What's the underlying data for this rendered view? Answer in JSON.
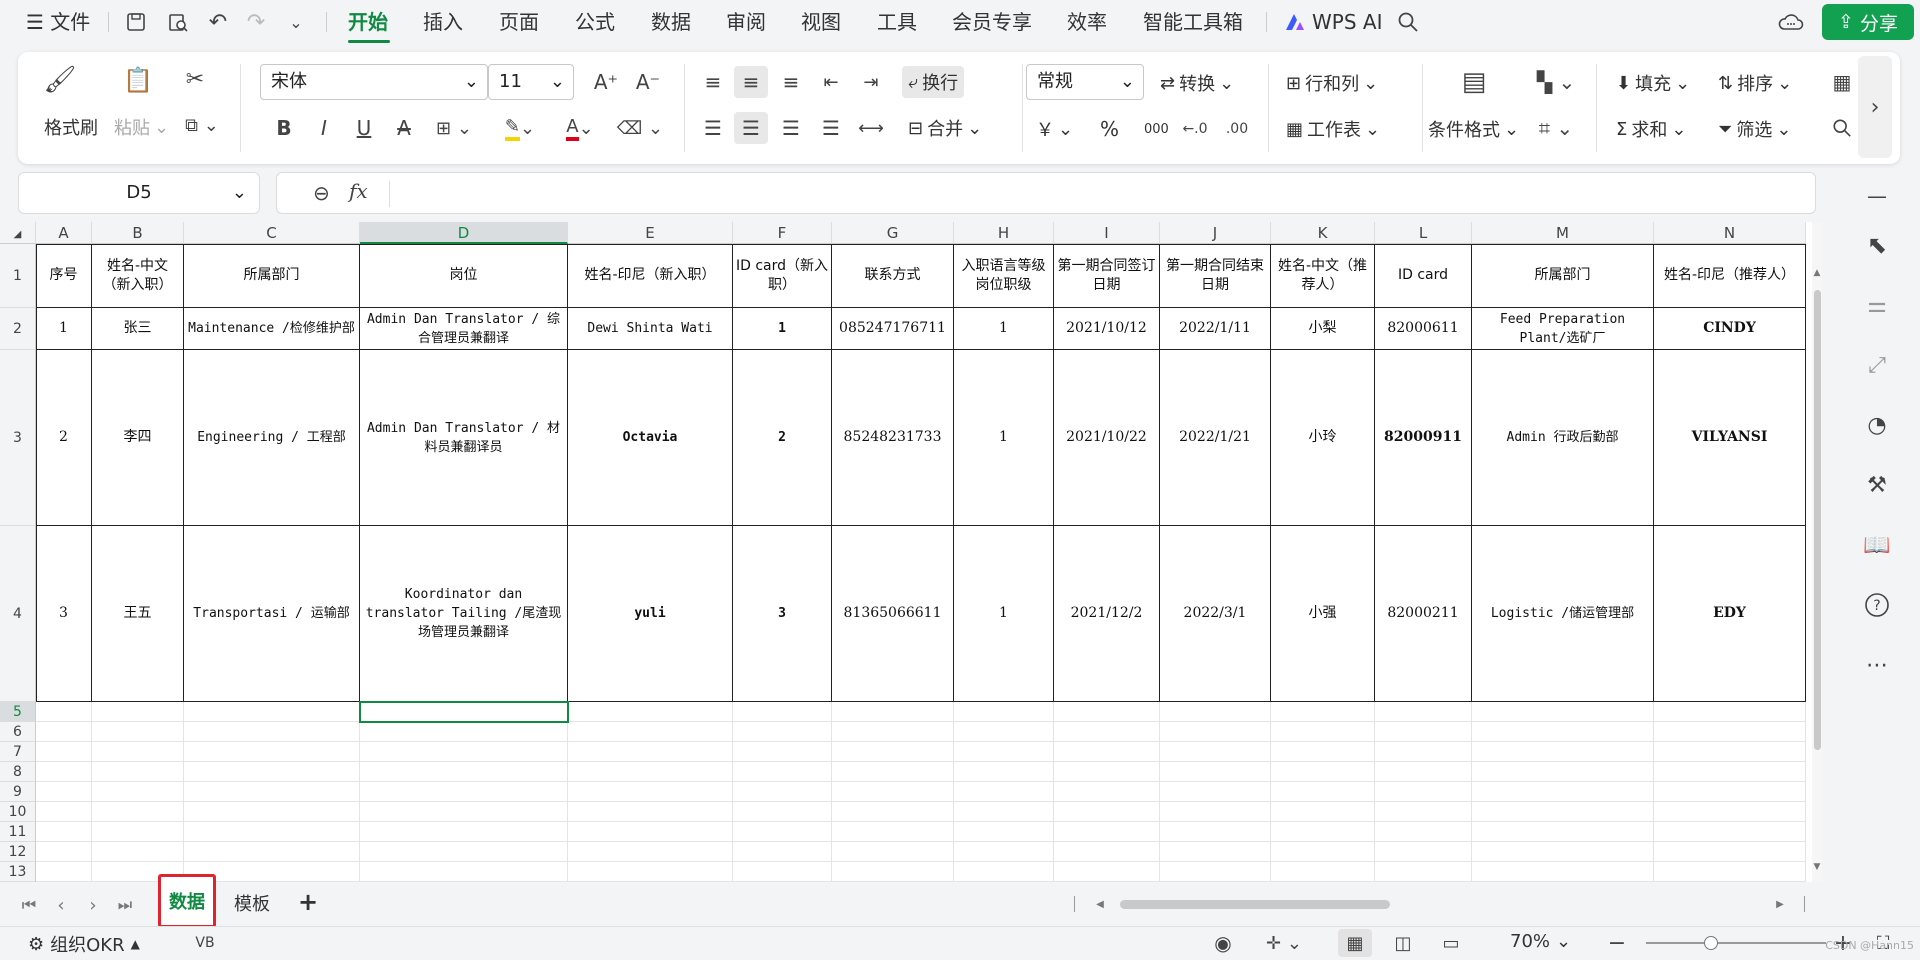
{
  "topbar": {
    "menu_label": "文件",
    "tabs": [
      "开始",
      "插入",
      "页面",
      "公式",
      "数据",
      "审阅",
      "视图",
      "工具",
      "会员专享",
      "效率",
      "智能工具箱"
    ],
    "active_tab_index": 0,
    "ai_label": "WPS AI",
    "share_label": "分享"
  },
  "ribbon": {
    "format_painter": "格式刷",
    "paste": "粘贴",
    "font_name": "宋体",
    "font_size": "11",
    "wrap": "换行",
    "merge": "合并",
    "number_format": "常规",
    "convert": "转换",
    "rows_cols": "行和列",
    "worksheet": "工作表",
    "conditional_format": "条件格式",
    "fill": "填充",
    "sort": "排序",
    "sum": "求和",
    "filter": "筛选",
    "currency_symbol": "￥",
    "percent_symbol": "%",
    "thousands_symbol": "000"
  },
  "formula_bar": {
    "name_box": "D5",
    "fx": "fx",
    "value": ""
  },
  "sheet": {
    "columns": [
      "A",
      "B",
      "C",
      "D",
      "E",
      "F",
      "G",
      "H",
      "I",
      "J",
      "K",
      "L",
      "M",
      "N"
    ],
    "selected_column": "D",
    "row_numbers": [
      "1",
      "2",
      "3",
      "4",
      "5",
      "6",
      "7",
      "8",
      "9",
      "10",
      "11",
      "12",
      "13"
    ],
    "selected_row": "5",
    "header_row": [
      "序号",
      "姓名-中文（新入职）",
      "所属部门",
      "岗位",
      "姓名-印尼（新入职）",
      "ID card（新入职）",
      "联系方式",
      "入职语言等级岗位职级",
      "第一期合同签订日期",
      "第一期合同结束日期",
      "姓名-中文（推荐人）",
      "ID card",
      "所属部门",
      "姓名-印尼（推荐人）"
    ],
    "rows": [
      [
        "1",
        "张三",
        "Maintenance /检修维护部",
        "Admin Dan Translator / 综合管理员兼翻译",
        "Dewi Shinta Wati",
        "1",
        "085247176711",
        "1",
        "2021/10/12",
        "2022/1/11",
        "小梨",
        "82000611",
        "Feed Preparation Plant/选矿厂",
        "CINDY"
      ],
      [
        "2",
        "李四",
        "Engineering / 工程部",
        "Admin Dan Translator / 材料员兼翻译员",
        "Octavia",
        "2",
        "85248231733",
        "1",
        "2021/10/22",
        "2022/1/21",
        "小玲",
        "82000911",
        "Admin 行政后勤部",
        "VILYANSI"
      ],
      [
        "3",
        "王五",
        "Transportasi / 运输部",
        "Koordinator dan translator Tailing /尾渣现场管理员兼翻译",
        "yuli",
        "3",
        "81365066611",
        "1",
        "2021/12/2",
        "2022/3/1",
        "小强",
        "82000211",
        "Logistic /储运管理部",
        "EDY"
      ]
    ]
  },
  "sheet_tabs": {
    "tabs": [
      "数据",
      "模板"
    ],
    "active_index": 0,
    "add_label": "+"
  },
  "statusbar": {
    "okr_label": "组织OKR",
    "zoom_label": "70%",
    "zoom_level_percent": 70,
    "watermark": "CSDN @Hann15"
  }
}
